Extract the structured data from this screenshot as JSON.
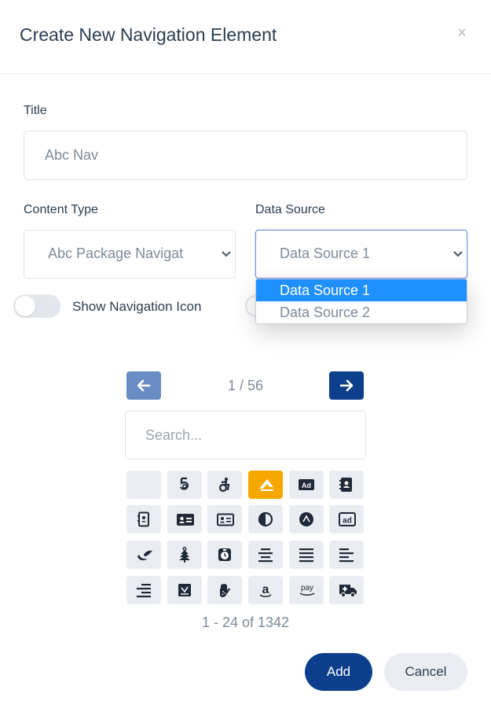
{
  "modal": {
    "title": "Create New Navigation Element",
    "close_symbol": "×"
  },
  "title_field": {
    "label": "Title",
    "value": "Abc Nav"
  },
  "content_type": {
    "label": "Content Type",
    "selected": "Abc Package Navigat"
  },
  "data_source": {
    "label": "Data Source",
    "selected": "Data Source 1",
    "options": [
      "Data Source 1",
      "Data Source 2"
    ]
  },
  "nav_icon_toggle": {
    "label": "Show Navigation Icon",
    "on": false
  },
  "pagination": {
    "text": "1 / 56"
  },
  "icon_search": {
    "placeholder": "Search..."
  },
  "icon_grid": {
    "icons": [
      "blank-icon",
      "500px-icon",
      "accessible-icon-icon",
      "accusoft-icon",
      "ad-icon",
      "address-book-icon",
      "address-book-outline-icon",
      "address-card-icon",
      "address-card-outline-icon",
      "adjust-icon",
      "adn-icon",
      "adversal-icon",
      "affiliatetheme-icon",
      "air-freshener-icon",
      "alarm-clock-icon",
      "align-center-icon",
      "align-justify-icon",
      "align-left-icon",
      "align-right-icon",
      "allergies-icon",
      "amazon-icon",
      "amazon-pay-icon",
      "ambulance-icon"
    ],
    "active_index": 3,
    "ad_label": "Ad",
    "ad_outline_label": "ad",
    "amazon_letter": "a",
    "pay_label": "pay"
  },
  "results_text": "1 - 24 of 1342",
  "actions": {
    "add_label": "Add",
    "cancel_label": "Cancel"
  },
  "colors": {
    "primary": "#0d3f8c",
    "accent": "#f6a800",
    "selected_option": "#1e90ff"
  }
}
